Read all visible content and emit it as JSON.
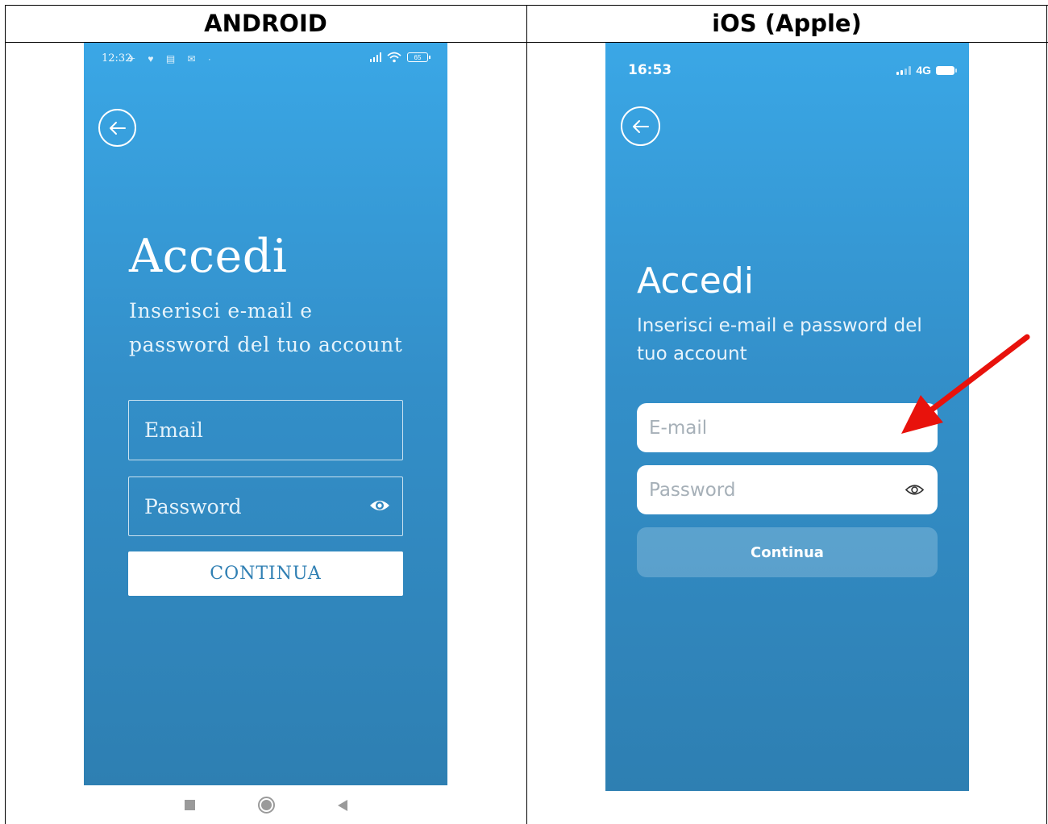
{
  "columns": {
    "android_header": "ANDROID",
    "ios_header": "iOS (Apple)"
  },
  "android": {
    "status_time": "12:32",
    "status_battery": "65",
    "title": "Accedi",
    "subtitle": "Inserisci e-mail e password del tuo account",
    "email_placeholder": "Email",
    "password_placeholder": "Password",
    "continue_label": "CONTINUA"
  },
  "ios": {
    "status_time": "16:53",
    "network": "4G",
    "title": "Accedi",
    "subtitle": "Inserisci e-mail e password del tuo account",
    "email_placeholder": "E-mail",
    "password_placeholder": "Password",
    "continue_label": "Continua"
  },
  "colors": {
    "gradient_top": "#3aa7e6",
    "gradient_bottom": "#2e7fb2",
    "annotation_arrow": "#e8120c",
    "android_button_text": "#2f7fb3"
  },
  "icons": {
    "back": "arrow-left-circle-icon",
    "password_toggle": "eye-icon",
    "annotation": "red-arrow-icon"
  }
}
